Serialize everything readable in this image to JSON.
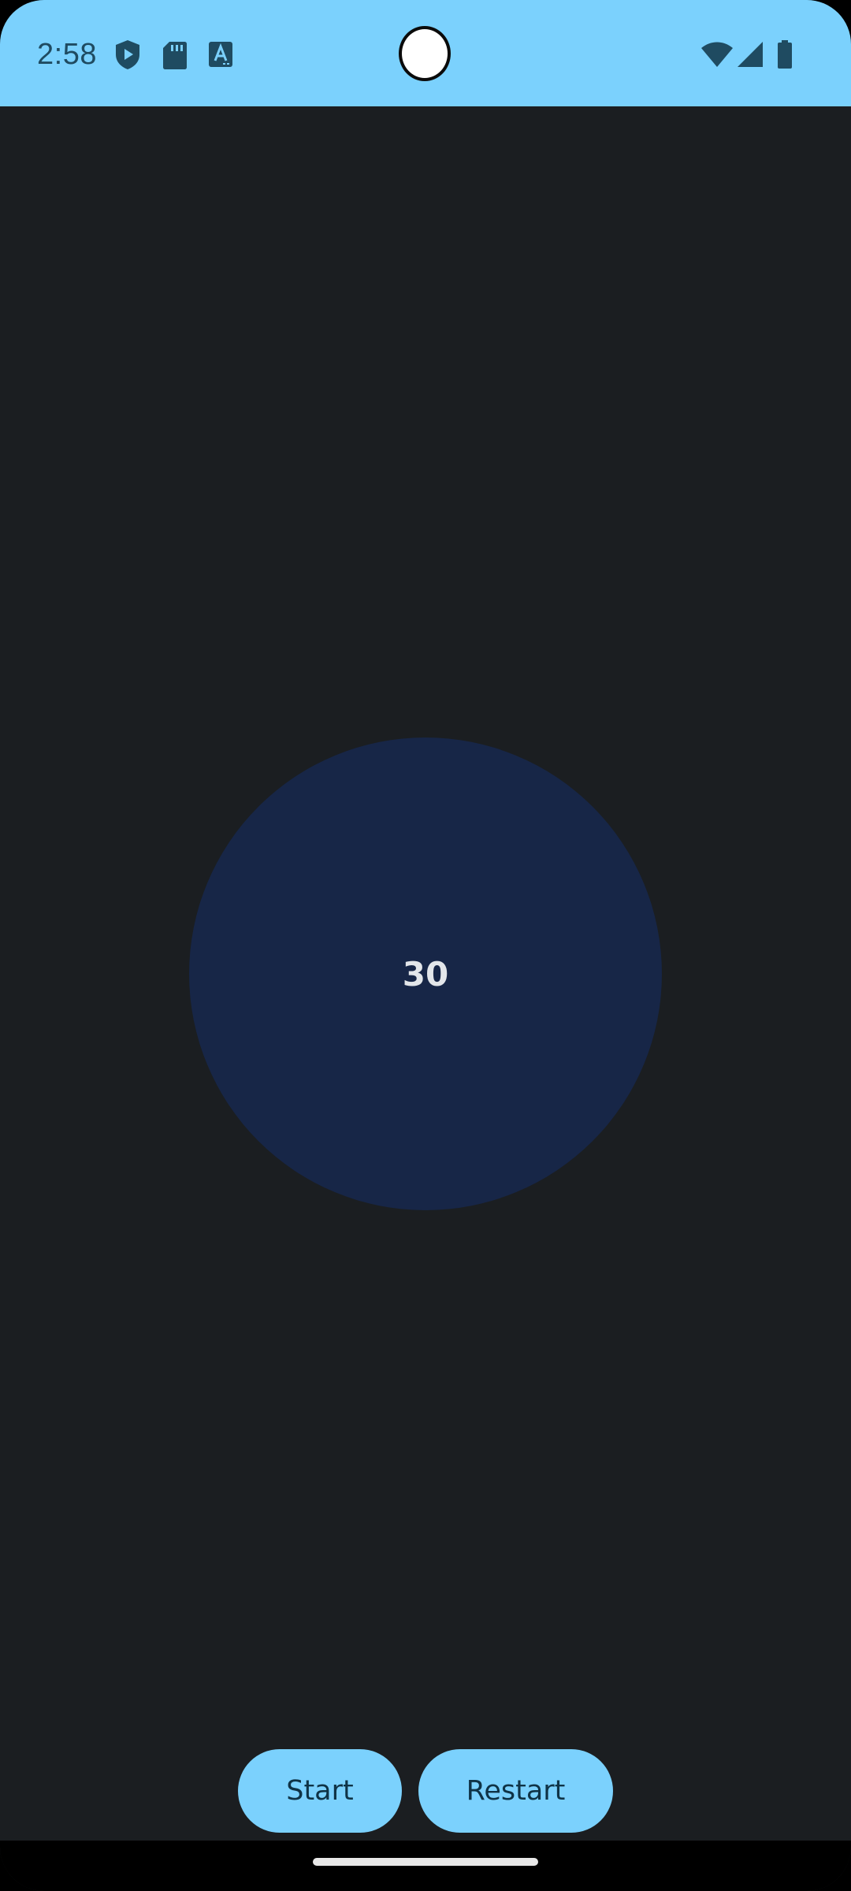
{
  "status_bar": {
    "time": "2:58",
    "left_icons": [
      "play-shield-icon",
      "sd-card-icon",
      "font-a-icon"
    ],
    "right_icons": [
      "wifi-icon",
      "cell-signal-icon",
      "battery-icon"
    ],
    "background_color": "#7bd1fd",
    "icon_color": "#1f4b61"
  },
  "timer": {
    "value": "30",
    "circle_color": "#172647"
  },
  "controls": {
    "start_label": "Start",
    "restart_label": "Restart",
    "button_color": "#7bd1fd"
  },
  "theme": {
    "background": "#1b1e21"
  }
}
